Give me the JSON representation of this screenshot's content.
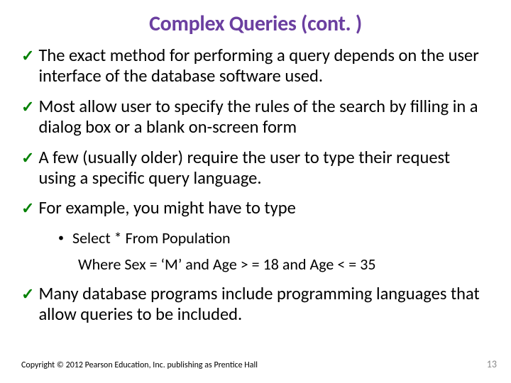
{
  "title": "Complex Queries (cont. )",
  "bullets": [
    "The exact method for performing a query depends on the user interface of the database software used.",
    "Most allow user to specify the rules of the search by filling in a dialog box or a blank on-screen form",
    "A few (usually older) require the user to type their request using a specific query language.",
    "For example, you might have to type"
  ],
  "sub": {
    "line1": "Select  *  From Population",
    "line2": "Where Sex = ‘M’  and Age > = 18  and Age < = 35"
  },
  "lastBullet": "Many database programs include programming languages that allow queries to be included.",
  "copyright": "Copyright © 2012 Pearson Education, Inc. publishing as Prentice Hall",
  "pageNumber": "13",
  "checkGlyph": "✓",
  "dotGlyph": "•"
}
